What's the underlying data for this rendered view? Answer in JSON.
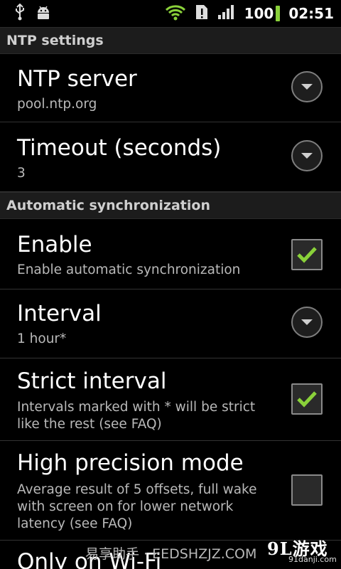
{
  "status_bar": {
    "icons_left": [
      "usb-icon",
      "android-debug-icon"
    ],
    "icons_right": [
      "wifi-icon",
      "alert-icon",
      "signal-icon"
    ],
    "battery": "100",
    "time": "02:51",
    "battery_color": "#8ad13a"
  },
  "sections": {
    "ntp_settings": "NTP settings",
    "automatic_sync": "Automatic synchronization"
  },
  "prefs": {
    "ntp_server": {
      "title": "NTP server",
      "summary": "pool.ntp.org"
    },
    "timeout": {
      "title": "Timeout (seconds)",
      "summary": "3"
    },
    "enable": {
      "title": "Enable",
      "summary": "Enable automatic synchronization",
      "checked": true
    },
    "interval": {
      "title": "Interval",
      "summary": "1 hour*"
    },
    "strict_interval": {
      "title": "Strict interval",
      "summary": "Intervals marked with * will be strict like the rest (see FAQ)",
      "checked": true
    },
    "high_precision": {
      "title": "High precision mode",
      "summary": "Average result of 5 offsets, full wake with screen on for lower network latency (see FAQ)",
      "checked": false
    },
    "only_wifi": {
      "title": "Only on Wi-Fi"
    }
  },
  "watermark": {
    "text": "易享助手 · EEDSHZJZ.COM",
    "brand": "9L游戏",
    "brand_sub": "91danji.com"
  },
  "colors": {
    "check_green": "#8ad13a",
    "section_bg": "#1c1c1c"
  }
}
